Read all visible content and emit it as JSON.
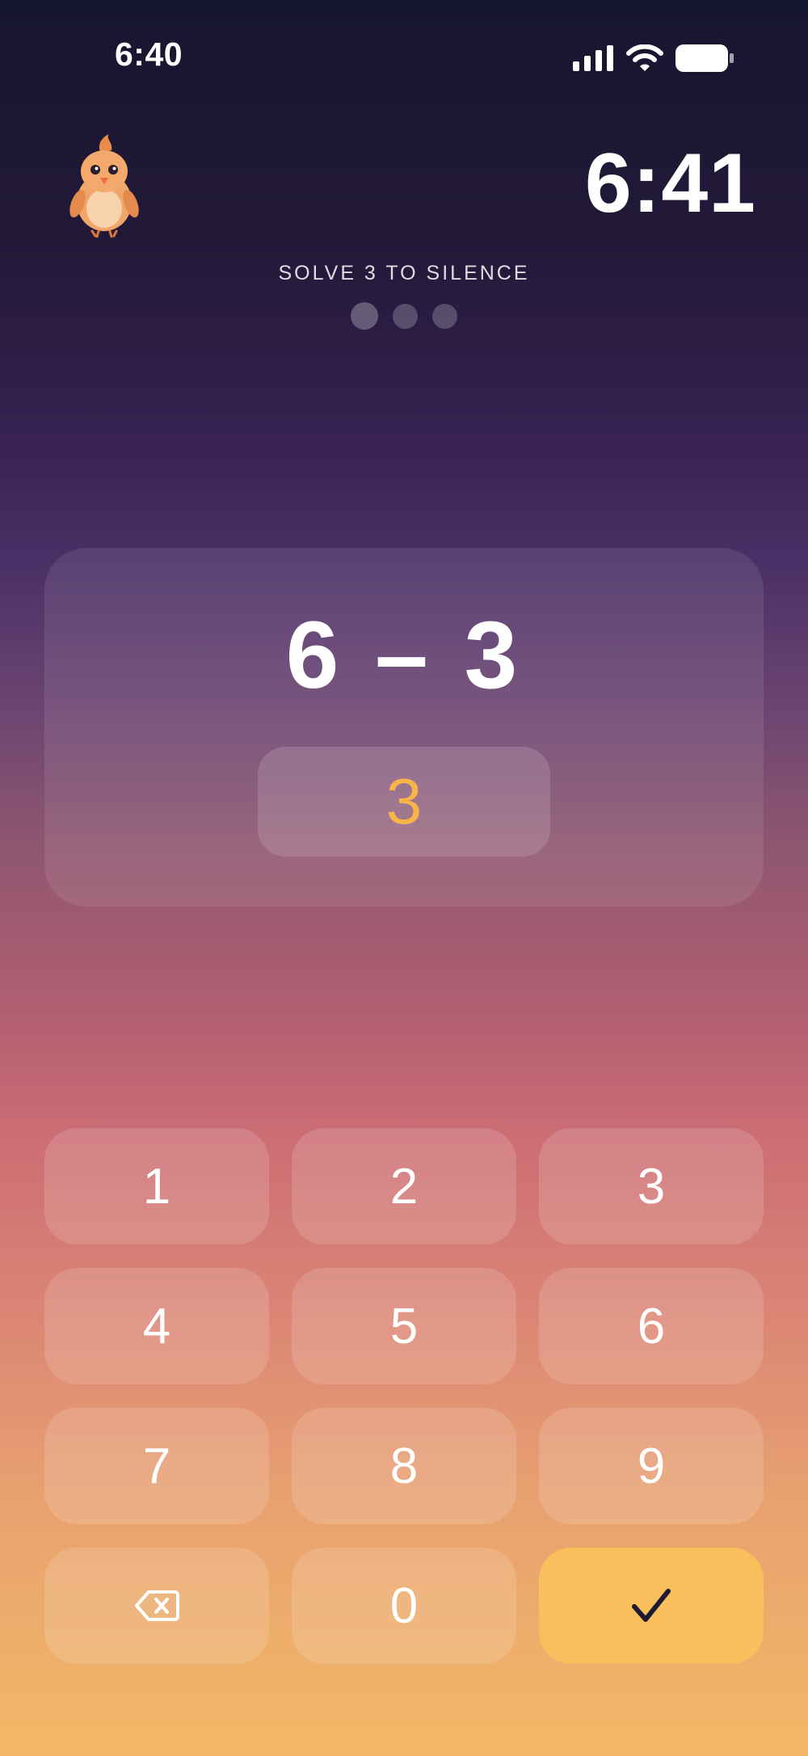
{
  "status_bar": {
    "time": "6:40",
    "icons": [
      "signal-icon",
      "wifi-icon",
      "battery-icon"
    ]
  },
  "header": {
    "mascot": "bird-mascot",
    "alarm_time": "6:41"
  },
  "challenge": {
    "instruction": "SOLVE 3 TO SILENCE",
    "total_problems": 3,
    "current_problem": 1
  },
  "problem": {
    "equation": "6 – 3",
    "answer": "3"
  },
  "keypad": {
    "keys": [
      "1",
      "2",
      "3",
      "4",
      "5",
      "6",
      "7",
      "8",
      "9"
    ],
    "zero": "0",
    "backspace_icon": "backspace-icon",
    "submit_icon": "checkmark-icon"
  },
  "colors": {
    "answer": "#f7b549",
    "submit_key": "#f8bf5c",
    "checkmark": "#1f1a33"
  }
}
